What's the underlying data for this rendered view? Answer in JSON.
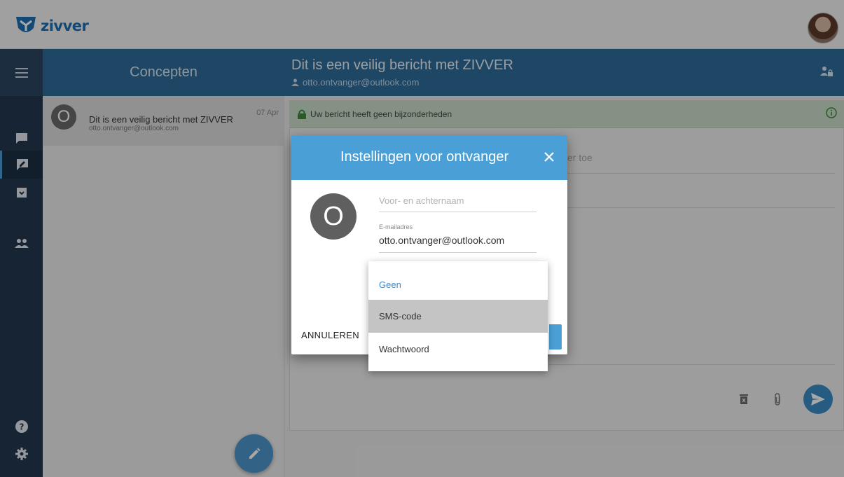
{
  "app": {
    "brand": "zivver"
  },
  "header": {
    "left_title": "Concepten",
    "subject": "Dit is een veilig bericht met ZIVVER",
    "recipient": "otto.ontvanger@outlook.com"
  },
  "drafts": [
    {
      "initial": "O",
      "subject": "Dit is een veilig bericht met ZIVVER",
      "email": "otto.ontvanger@outlook.com",
      "date": "07 Apr"
    }
  ],
  "compose": {
    "notice": "Uw bericht heeft geen bijzonderheden",
    "peek_text": "er toe"
  },
  "dialog": {
    "title": "Instellingen voor ontvanger",
    "avatar_initial": "O",
    "name_placeholder": "Voor- en achternaam",
    "email_label": "E-mailadres",
    "email_value": "otto.ontvanger@outlook.com",
    "cancel_label": "ANNULEREN"
  },
  "dropdown": {
    "options": [
      "Geen",
      "SMS-code",
      "Wachtwoord"
    ],
    "selected": "Geen",
    "hovered": "SMS-code"
  },
  "colors": {
    "accent": "#4aa0d6",
    "header": "#2e6d99",
    "rail": "#22384e",
    "notice": "#c8dcc8"
  },
  "icons": [
    "menu-icon",
    "chat-icon",
    "edit-message-icon",
    "archive-icon",
    "group-icon",
    "help-icon",
    "settings-icon",
    "person-icon",
    "person-lock-icon",
    "lock-icon",
    "info-icon",
    "close-icon",
    "trash-icon",
    "paperclip-icon",
    "send-icon",
    "pencil-icon"
  ]
}
